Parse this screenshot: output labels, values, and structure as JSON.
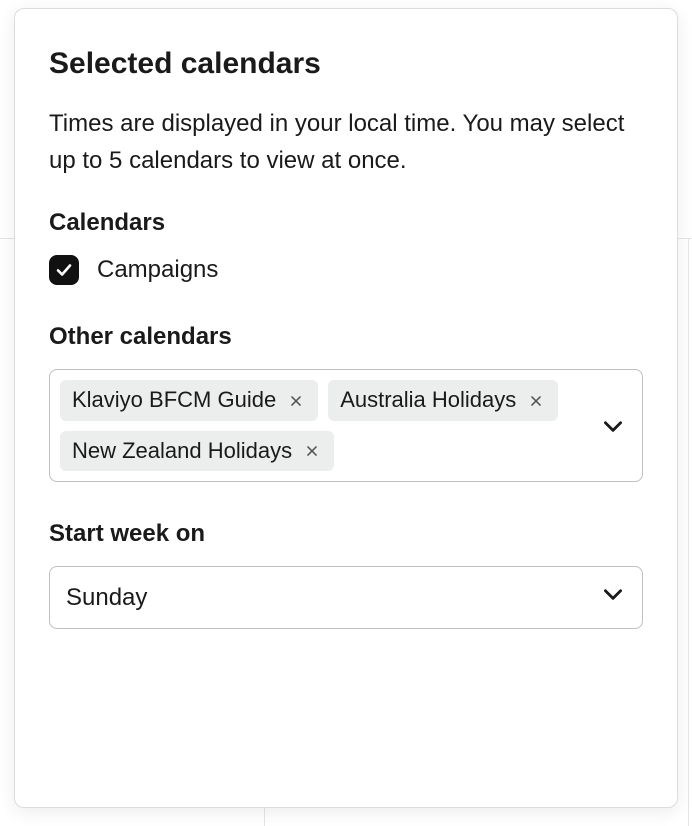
{
  "panel": {
    "title": "Selected calendars",
    "description": "Times are displayed in your local time. You may select up to 5 calendars to view at once."
  },
  "calendars": {
    "label": "Calendars",
    "items": [
      {
        "name": "Campaigns",
        "checked": true
      }
    ]
  },
  "otherCalendars": {
    "label": "Other calendars",
    "selected": [
      "Klaviyo BFCM Guide",
      "Australia Holidays",
      "New Zealand Holidays"
    ]
  },
  "startWeek": {
    "label": "Start week on",
    "value": "Sunday"
  }
}
